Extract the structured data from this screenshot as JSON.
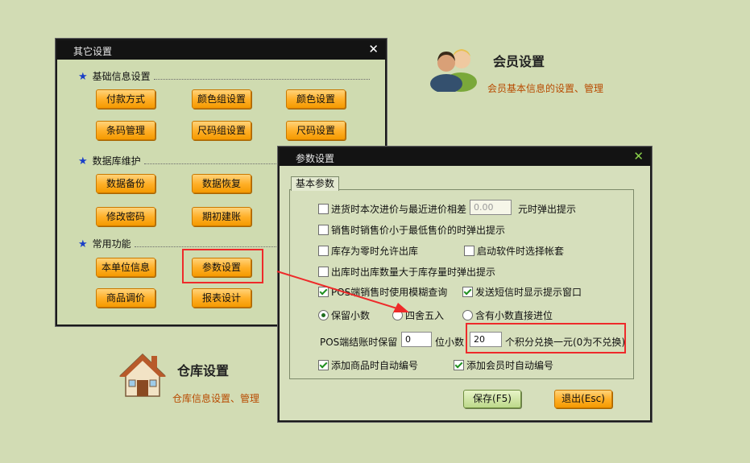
{
  "colors": {
    "accent_orange": "#ffb02a",
    "annotation_red": "#ee2a2a",
    "titlebar": "#131313",
    "background": "#d2dcb4"
  },
  "member": {
    "title": "会员设置",
    "subtitle": "会员基本信息的设置、管理",
    "icon": "users-icon"
  },
  "warehouse": {
    "title": "仓库设置",
    "subtitle": "仓库信息设置、管理",
    "icon": "house-icon"
  },
  "other_window": {
    "title": "其它设置",
    "close_label": "✕",
    "sections": [
      {
        "label": "基础信息设置",
        "buttons": [
          "付款方式",
          "颜色组设置",
          "颜色设置",
          "条码管理",
          "尺码组设置",
          "尺码设置"
        ]
      },
      {
        "label": "数据库维护",
        "buttons": [
          "数据备份",
          "数据恢复",
          "修改密码",
          "期初建账"
        ]
      },
      {
        "label": "常用功能",
        "buttons": [
          "本单位信息",
          "参数设置",
          "商品调价",
          "报表设计"
        ]
      }
    ]
  },
  "param_window": {
    "title": "参数设置",
    "close_label": "✕",
    "tab_label": "基本参数",
    "opt_price_diff": {
      "label": "进货时本次进价与最近进价相差",
      "value": "0.00",
      "suffix": "元时弹出提示",
      "checked": false
    },
    "opt_min_price": {
      "label": "销售时销售价小于最低售价的时弹出提示",
      "checked": false
    },
    "opt_zero_stock": {
      "label": "库存为零时允许出库",
      "checked": false
    },
    "opt_select_account": {
      "label": "启动软件时选择帐套",
      "checked": false
    },
    "opt_exceed_stock": {
      "label": "出库时出库数量大于库存量时弹出提示",
      "checked": false
    },
    "opt_fuzzy": {
      "label": "POS端销售时使用模糊查询",
      "checked": true
    },
    "opt_sms": {
      "label": "发送短信时显示提示窗口",
      "checked": true
    },
    "radio_keep": {
      "label": "保留小数",
      "checked": true
    },
    "radio_round": {
      "label": "四舍五入",
      "checked": false
    },
    "radio_carry": {
      "label": "含有小数直接进位",
      "checked": false
    },
    "pos_decimal": {
      "label": "POS端结账时保留",
      "value": "0",
      "suffix": "位小数"
    },
    "points": {
      "value": "20",
      "suffix": "个积分兑换一元(0为不兑换)"
    },
    "opt_auto_goods": {
      "label": "添加商品时自动编号",
      "checked": true
    },
    "opt_auto_member": {
      "label": "添加会员时自动编号",
      "checked": true
    },
    "save_label": "保存(F5)",
    "exit_label": "退出(Esc)"
  }
}
